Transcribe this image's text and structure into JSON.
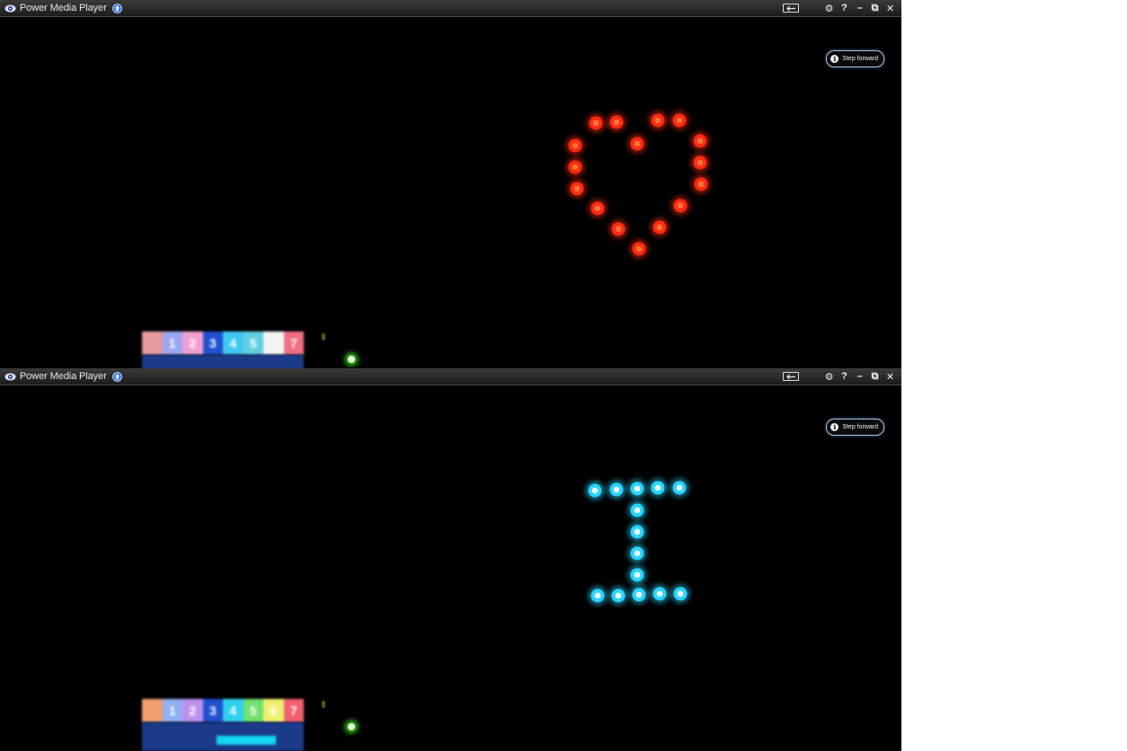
{
  "app": {
    "title": "Power Media Player",
    "icons": [
      "eye-logo-icon",
      "update-arrow-icon",
      "back-arrow-icon",
      "gear-icon",
      "help-icon",
      "minimize-icon",
      "restore-icon",
      "close-icon"
    ]
  },
  "titlebar": {
    "help_glyph": "?",
    "minimize_glyph": "–",
    "restore_glyph": "⧉",
    "close_glyph": "✕",
    "gear_glyph": "⚙"
  },
  "step_button": {
    "label": "Step forward",
    "info_glyph": "i"
  },
  "frames": [
    {
      "pattern": "heart",
      "led_color": "#ff2a10",
      "keypad": [
        "",
        "1",
        "2",
        "3",
        "4",
        "5",
        "",
        "7"
      ],
      "keypad_colors": [
        "#e89aa0",
        "#9aa8f0",
        "#f0a0d0",
        "#2050d0",
        "#40c8f0",
        "#60d0e0",
        "#f4f4f4",
        "#f07080"
      ]
    },
    {
      "pattern": "letter-I",
      "led_color": "#29d4ff",
      "keypad": [
        "",
        "1",
        "2",
        "3",
        "4",
        "5",
        "6",
        "7"
      ],
      "keypad_colors": [
        "#f0a070",
        "#90b0f0",
        "#c090f0",
        "#2050d0",
        "#30d0f0",
        "#70e070",
        "#f0f070",
        "#f06070"
      ]
    }
  ]
}
